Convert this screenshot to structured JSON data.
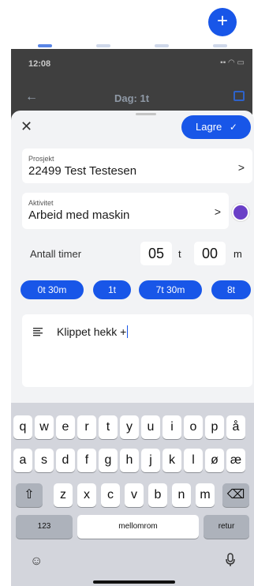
{
  "fab": {
    "label": "+"
  },
  "status": {
    "time": "12:08",
    "icons": "▪▪ ◠ ▭"
  },
  "header": {
    "back": "←",
    "title": "Dag: 1t"
  },
  "sheet": {
    "close": "✕",
    "save_label": "Lagre",
    "save_check": "✓",
    "project": {
      "label": "Prosjekt",
      "value": "22499 Test Testesen",
      "chevron": ">"
    },
    "activity": {
      "label": "Aktivitet",
      "value": "Arbeid med maskin",
      "chevron": ">",
      "color": "#6a3fc7"
    },
    "hours": {
      "label": "Antall timer",
      "hours_value": "05",
      "hours_unit": "t",
      "minutes_value": "00",
      "minutes_unit": "m"
    },
    "chips": [
      "0t 30m",
      "1t",
      "7t 30m",
      "8t"
    ],
    "note": {
      "icon": "notes-icon",
      "text": "Klippet hekk +"
    }
  },
  "keyboard": {
    "row1": [
      "q",
      "w",
      "e",
      "r",
      "t",
      "y",
      "u",
      "i",
      "o",
      "p",
      "å"
    ],
    "row2": [
      "a",
      "s",
      "d",
      "f",
      "g",
      "h",
      "j",
      "k",
      "l",
      "ø",
      "æ"
    ],
    "row3": [
      "z",
      "x",
      "c",
      "v",
      "b",
      "n",
      "m"
    ],
    "shift": "⇧",
    "backspace": "⌫",
    "numbers": "123",
    "space": "mellomrom",
    "return": "retur",
    "emoji": "☺",
    "mic": "🎙"
  },
  "colors": {
    "accent": "#1856e8",
    "sheet_bg": "#f2f3f5",
    "keyboard_bg": "#d3d5dc"
  }
}
